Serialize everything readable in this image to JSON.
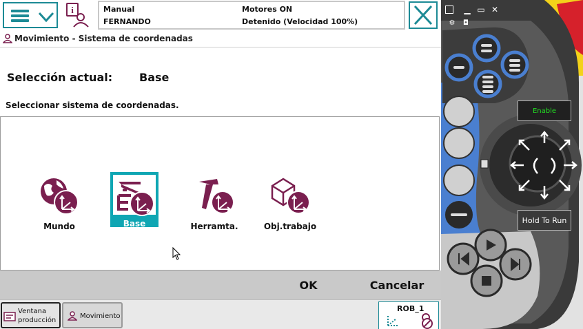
{
  "status": {
    "mode": "Manual",
    "user": "FERNANDO",
    "motors": "Motores ON",
    "state": "Detenido (Velocidad 100%)"
  },
  "window": {
    "title": "Movimiento - Sistema de coordenadas"
  },
  "selection": {
    "current_label": "Selección actual:",
    "current_value": "Base",
    "instruction": "Seleccionar sistema de coordenadas.",
    "options": [
      {
        "label": "Mundo",
        "icon": "world-coordinate-icon",
        "selected": false
      },
      {
        "label": "Base",
        "icon": "base-coordinate-icon",
        "selected": true
      },
      {
        "label": "Herramta.",
        "icon": "tool-coordinate-icon",
        "selected": false
      },
      {
        "label": "Obj.trabajo",
        "icon": "workobject-coordinate-icon",
        "selected": false
      }
    ]
  },
  "actions": {
    "ok": "OK",
    "cancel": "Cancelar"
  },
  "taskbar": {
    "production_window": "Ventana producción",
    "production_line1": "Ventana",
    "production_line2": "producción",
    "movement": "Movimiento",
    "robot": "ROB_1"
  },
  "pendant": {
    "enable": "Enable",
    "hold_to_run": "Hold To Run"
  },
  "colors": {
    "accent": "#1c8a95",
    "selected": "#0fa6b3",
    "icon_purple": "#7a1f4f",
    "pendant_blue": "#4a7fd0",
    "pendant_dark": "#2a2a2a"
  }
}
